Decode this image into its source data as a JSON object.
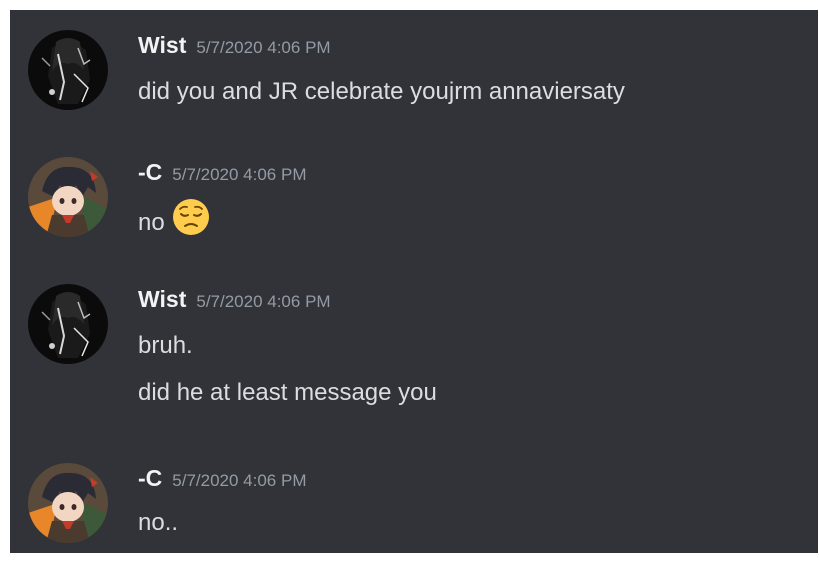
{
  "messages": [
    {
      "author": "Wist",
      "timestamp": "5/7/2020 4:06 PM",
      "avatar": "dark-monochrome-avatar",
      "lines": [
        "did you and JR celebrate youjrm annaviersaty"
      ]
    },
    {
      "author": "-C",
      "timestamp": "5/7/2020 4:06 PM",
      "avatar": "anime-character-avatar",
      "lines": [
        "no"
      ],
      "emoji": "pensive-face-emoji"
    },
    {
      "author": "Wist",
      "timestamp": "5/7/2020 4:06 PM",
      "avatar": "dark-monochrome-avatar",
      "lines": [
        "bruh.",
        "did he at least message you"
      ]
    },
    {
      "author": "-C",
      "timestamp": "5/7/2020 4:06 PM",
      "avatar": "anime-character-avatar",
      "lines": [
        "no.."
      ]
    }
  ],
  "colors": {
    "background": "#313338",
    "username": "#f2f3f5",
    "timestamp": "#949ba4",
    "message_text": "#dbdee1",
    "emoji_yellow": "#ffcc4d"
  }
}
